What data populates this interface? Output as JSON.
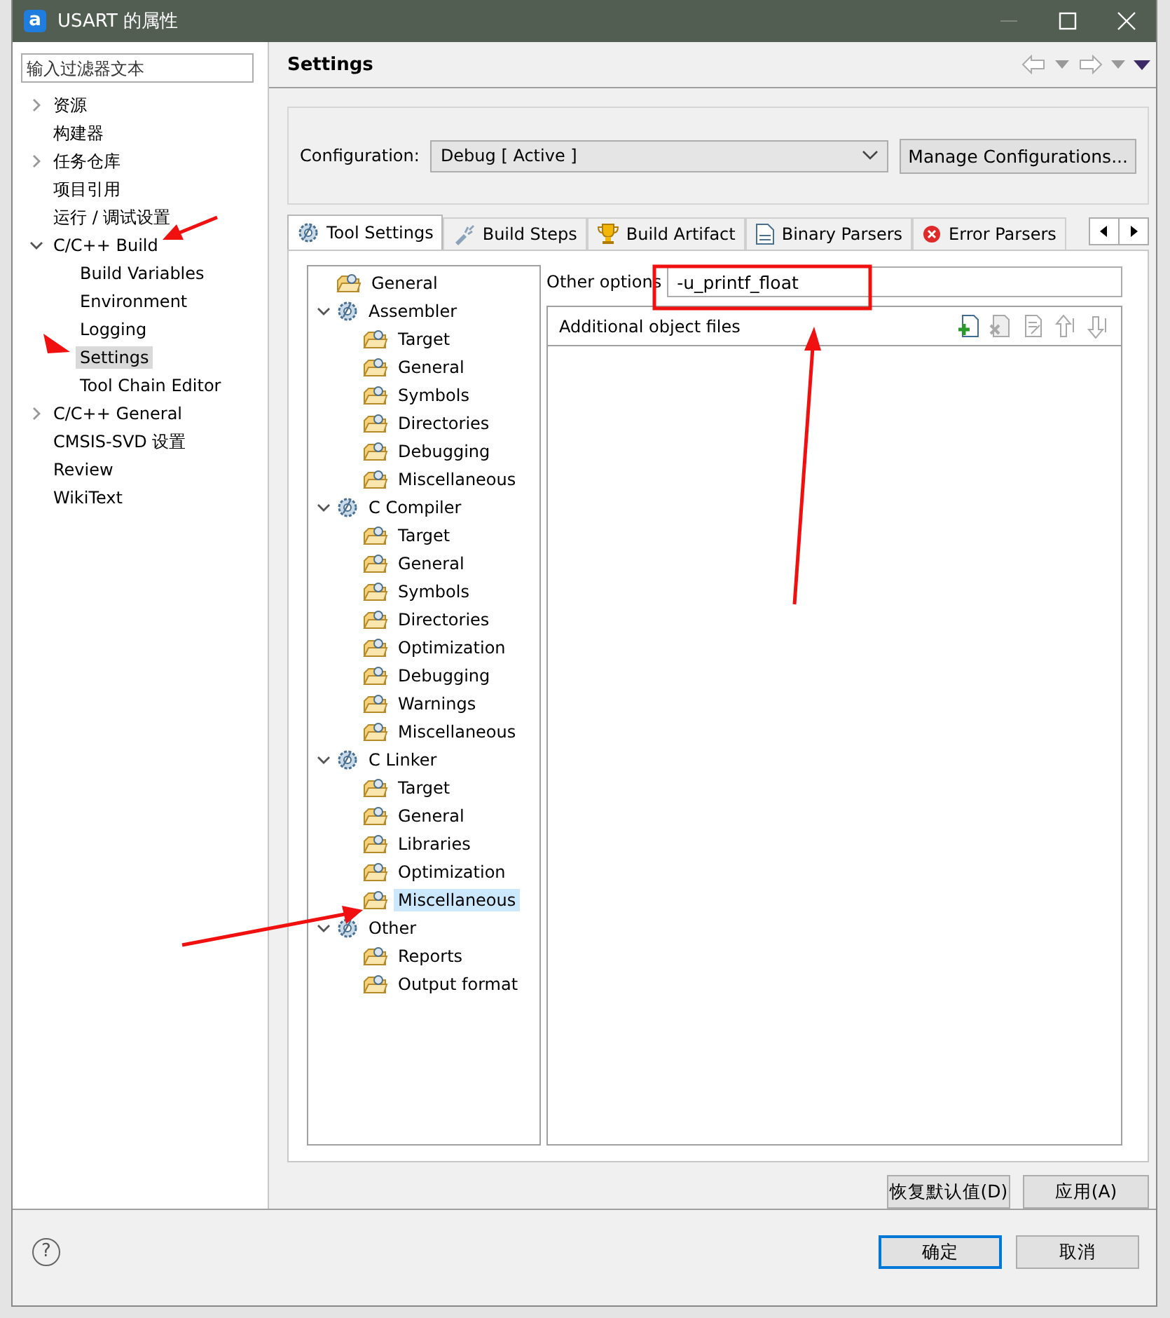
{
  "window": {
    "logo": "a",
    "title": "USART 的属性"
  },
  "filter": {
    "placeholder": "输入过滤器文本"
  },
  "nav": [
    {
      "label": "资源",
      "expanded": false,
      "selected": false
    },
    {
      "label": "构建器",
      "selected": false
    },
    {
      "label": "任务仓库",
      "expanded": false,
      "selected": false
    },
    {
      "label": "项目引用",
      "selected": false
    },
    {
      "label": "运行 / 调试设置",
      "selected": false
    },
    {
      "label": "C/C++ Build",
      "expanded": true,
      "selected": false,
      "children": [
        {
          "label": "Build Variables",
          "selected": false
        },
        {
          "label": "Environment",
          "selected": false
        },
        {
          "label": "Logging",
          "selected": false
        },
        {
          "label": "Settings",
          "selected": true
        },
        {
          "label": "Tool Chain Editor",
          "selected": false
        }
      ]
    },
    {
      "label": "C/C++ General",
      "expanded": false,
      "selected": false
    },
    {
      "label": "CMSIS-SVD 设置",
      "selected": false
    },
    {
      "label": "Review",
      "selected": false
    },
    {
      "label": "WikiText",
      "selected": false
    }
  ],
  "page_title": "Settings",
  "configuration": {
    "label": "Configuration:",
    "value": "Debug  [ Active ]",
    "button": "Manage Configurations..."
  },
  "tabs": [
    {
      "label": "Tool Settings",
      "kind": "tool",
      "selected": true
    },
    {
      "label": "Build Steps",
      "kind": "steps",
      "selected": false
    },
    {
      "label": "Build Artifact",
      "kind": "artifact",
      "selected": false
    },
    {
      "label": "Binary Parsers",
      "kind": "binary",
      "selected": false
    },
    {
      "label": "Error Parsers",
      "kind": "error",
      "selected": false
    }
  ],
  "tool_tree": [
    {
      "label": "General",
      "kind": "option",
      "selected": false
    },
    {
      "label": "Assembler",
      "kind": "category",
      "expanded": true,
      "selected": false,
      "children": [
        {
          "label": "Target",
          "kind": "option",
          "selected": false
        },
        {
          "label": "General",
          "kind": "option",
          "selected": false
        },
        {
          "label": "Symbols",
          "kind": "option",
          "selected": false
        },
        {
          "label": "Directories",
          "kind": "option",
          "selected": false
        },
        {
          "label": "Debugging",
          "kind": "option",
          "selected": false
        },
        {
          "label": "Miscellaneous",
          "kind": "option",
          "selected": false
        }
      ]
    },
    {
      "label": "C Compiler",
      "kind": "category",
      "expanded": true,
      "selected": false,
      "children": [
        {
          "label": "Target",
          "kind": "option",
          "selected": false
        },
        {
          "label": "General",
          "kind": "option",
          "selected": false
        },
        {
          "label": "Symbols",
          "kind": "option",
          "selected": false
        },
        {
          "label": "Directories",
          "kind": "option",
          "selected": false
        },
        {
          "label": "Optimization",
          "kind": "option",
          "selected": false
        },
        {
          "label": "Debugging",
          "kind": "option",
          "selected": false
        },
        {
          "label": "Warnings",
          "kind": "option",
          "selected": false
        },
        {
          "label": "Miscellaneous",
          "kind": "option",
          "selected": false
        }
      ]
    },
    {
      "label": "C Linker",
      "kind": "category",
      "expanded": true,
      "selected": false,
      "children": [
        {
          "label": "Target",
          "kind": "option",
          "selected": false
        },
        {
          "label": "General",
          "kind": "option",
          "selected": false
        },
        {
          "label": "Libraries",
          "kind": "option",
          "selected": false
        },
        {
          "label": "Optimization",
          "kind": "option",
          "selected": false
        },
        {
          "label": "Miscellaneous",
          "kind": "option",
          "selected": true
        }
      ]
    },
    {
      "label": "Other",
      "kind": "category",
      "expanded": true,
      "selected": false,
      "children": [
        {
          "label": "Reports",
          "kind": "option",
          "selected": false
        },
        {
          "label": "Output format",
          "kind": "option",
          "selected": false
        }
      ]
    }
  ],
  "other_options": {
    "label": "Other options",
    "value": "-u_printf_float"
  },
  "object_files": {
    "header": "Additional object files",
    "tools": [
      {
        "kind": "add",
        "disabled": false
      },
      {
        "kind": "delete",
        "disabled": true
      },
      {
        "kind": "edit",
        "disabled": true
      },
      {
        "kind": "up",
        "disabled": true
      },
      {
        "kind": "down",
        "disabled": true
      }
    ]
  },
  "page_buttons": [
    {
      "label": "恢复默认值(D)"
    },
    {
      "label": "应用(A)"
    }
  ],
  "help": "?",
  "dialog_buttons": [
    {
      "label": "确定",
      "default": true
    },
    {
      "label": "取消",
      "default": false
    }
  ]
}
